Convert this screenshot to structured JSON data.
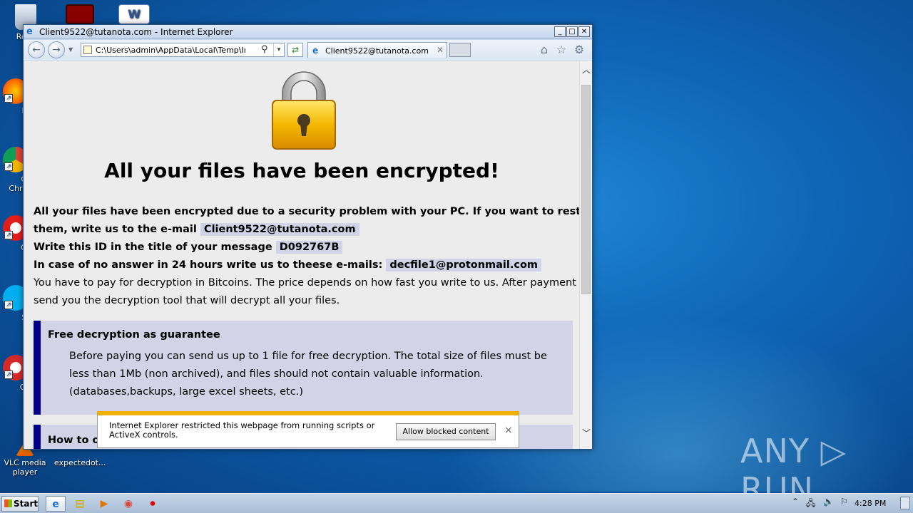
{
  "desktop": {
    "icons": [
      {
        "name": "recycle-bin",
        "label": "Recy"
      },
      {
        "name": "firefox",
        "label": "Fir"
      },
      {
        "name": "google-chrome",
        "label": "Go\nChr"
      },
      {
        "name": "opera",
        "label": "Op"
      },
      {
        "name": "skype",
        "label": "Sk"
      },
      {
        "name": "ccleaner",
        "label": "CCl"
      },
      {
        "name": "vlc",
        "label": "VLC media\nplayer"
      },
      {
        "name": "expected-file",
        "label": "expectedot..."
      }
    ],
    "watermark": "ANY ▷ RUN"
  },
  "window": {
    "title": "Client9522@tutanota.com - Internet Explorer",
    "buttons": {
      "minimize": "_",
      "maximize": "□",
      "close": "✕"
    },
    "address": {
      "url": "C:\\Users\\admin\\AppData\\Local\\Temp\\Info.hta.",
      "search_glyph": "⚲",
      "dropdown_glyph": "▾"
    },
    "tab": {
      "label": "Client9522@tutanota.com",
      "close": "✕"
    },
    "toolbar_icons": [
      "home-icon",
      "favorites-star-icon",
      "settings-gear-icon"
    ]
  },
  "page": {
    "heading": "All your files have been encrypted!",
    "line1": "All your files have been encrypted due to a security problem with your PC. If you want to restore",
    "line2_prefix": "them, write us to the e-mail",
    "email1": "Client9522@tutanota.com",
    "line3_prefix": "Write this ID in the title of your message",
    "id": "D092767B",
    "line4_prefix": "In case of no answer in 24 hours write us to theese e-mails:",
    "email2": "decfile1@protonmail.com",
    "line5": "You have to pay for decryption in Bitcoins. The price depends on how fast you write to us. After payment we will",
    "line6": "send you the decryption tool that will decrypt all your files.",
    "box1_title": "Free decryption as guarantee",
    "box1_body": "Before paying you can send us up to 1 file for free decryption. The total size of files must be less than 1Mb (non archived), and files should not contain valuable information. (databases,backups, large excel sheets, etc.)",
    "box2_title": "How to ol"
  },
  "notification": {
    "message": "Internet Explorer restricted this webpage from running scripts or ActiveX controls.",
    "allow_label": "Allow blocked content",
    "close": "×"
  },
  "taskbar": {
    "start_label": "Start",
    "clock": "4:28 PM"
  }
}
